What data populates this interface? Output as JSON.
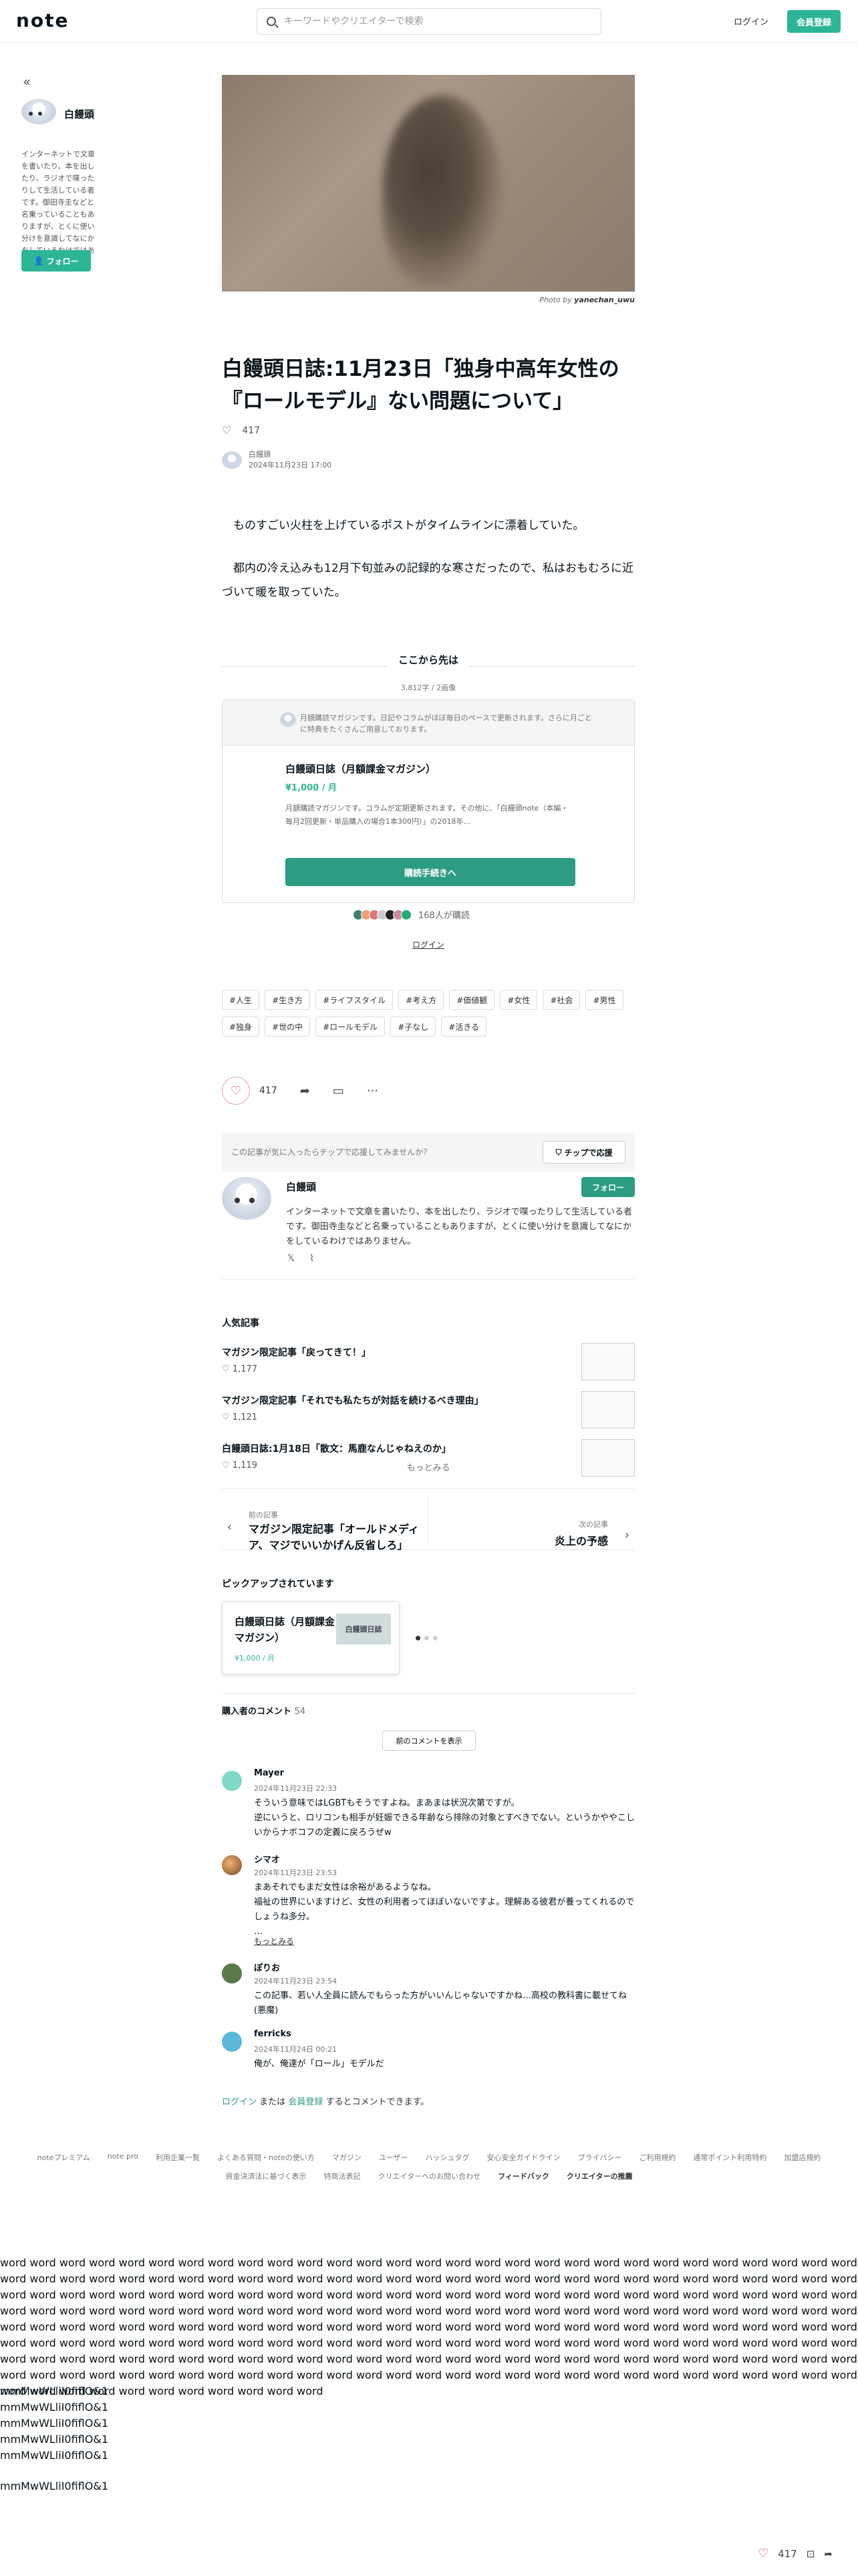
{
  "header": {
    "logo": "note",
    "search_placeholder": "キーワードやクリエイターで検索",
    "login": "ログイン",
    "signup": "会員登録"
  },
  "sidebar": {
    "collapse": "«",
    "name": "白饅頭",
    "bio": "インターネットで文章を書いたり、本を出したり、ラジオで喋ったりして生活している者です。御田寺圭などと名乗っていることもありますが、とくに使い分けを意識してなにかをしているわけではありません。",
    "follow": "フォロー"
  },
  "article": {
    "photo_credit_prefix": "Photo by",
    "photo_credit_name": "yanechan_uwu",
    "title": "白饅頭日誌:11月23日「独身中高年女性の『ロールモデル』ない問題について」",
    "like_count": "417",
    "author_name": "白饅頭",
    "date": "2024年11月23日 17:00",
    "p1": "ものすごい火柱を上げているポストがタイムラインに漂着していた。",
    "p2": "都内の冷え込みも12月下旬並みの記録的な寒さだったので、私はおもむろに近づいて暖を取っていた。"
  },
  "paywall": {
    "heading": "ここから先は",
    "count": "3,812字 / 2画像",
    "notice": "月額購読マガジンです。日記やコラムがほぼ毎日のペースで更新されます。さらに月ごとに特典をたくさんご用意しております。",
    "magazine_title": "白饅頭日誌（月額課金マガジン）",
    "price": "¥1,000 / 月",
    "desc": "月額購読マガジンです。コラムが定期更新されます。その他に、「白饅頭note（本編・毎月2回更新・単品購入の場合1本300円）」の2018年…",
    "buy": "購読手続きへ",
    "buyers": "168人が購読",
    "login": "ログイン"
  },
  "tags": [
    "#人生",
    "#生き方",
    "#ライフスタイル",
    "#考え方",
    "#価値観",
    "#女性",
    "#社会",
    "#男性",
    "#独身",
    "#世の中",
    "#ロールモデル",
    "#子なし",
    "#活きる"
  ],
  "actions": {
    "like_count": "417"
  },
  "tip": {
    "text": "この記事が気に入ったらチップで応援してみませんか？",
    "button": "チップで応援"
  },
  "creator": {
    "name": "白饅頭",
    "follow": "フォロー",
    "bio": "インターネットで文章を書いたり、本を出したり、ラジオで喋ったりして生活している者です。御田寺圭などと名乗っていることもありますが、とくに使い分けを意識してなにかをしているわけではありません。"
  },
  "popular": {
    "heading": "人気記事",
    "items": [
      {
        "title": "マガジン限定記事「戻ってきて！」",
        "likes": "1,177"
      },
      {
        "title": "マガジン限定記事「それでも私たちが対話を続けるべき理由」",
        "likes": "1,121"
      },
      {
        "title": "白饅頭日誌:1月18日「散文：馬鹿なんじゃねえのか」",
        "likes": "1,119"
      }
    ],
    "more": "もっとみる"
  },
  "navigation": {
    "prev_label": "前の記事",
    "prev_title": "マガジン限定記事「オールドメディア、マジでいいかげん反省しろ」",
    "next_label": "次の記事",
    "next_title": "炎上の予感"
  },
  "pickup": {
    "heading": "ピックアップされています",
    "name": "白饅頭日誌（月額課金マガジン）",
    "price": "¥1,000 / 月",
    "thumb_text": "白饅頭日誌"
  },
  "comments": {
    "heading": "購入者のコメント",
    "count": "54",
    "prev_button": "前のコメントを表示",
    "items": [
      {
        "name": "Mayer",
        "date": "2024年11月23日 22:33",
        "body": "そういう意味ではLGBTもそうですよね。まあまは状況次第ですが。\n逆にいうと、ロリコンも相手が妊娠できる年齢なら排除の対象とすべきでない。というかややこしいからナボコフの定義に戻ろうぜw",
        "more": ""
      },
      {
        "name": "シマオ",
        "date": "2024年11月23日 23:53",
        "body": "まあそれでもまだ女性は余裕があるようなね。\n福祉の世界にいますけど、女性の利用者ってほぼいないですよ。理解ある彼君が養ってくれるのでしょうね多分。\n…",
        "more": "もっとみる"
      },
      {
        "name": "ぽりお",
        "date": "2024年11月23日 23:54",
        "body": "この記事、若い人全員に読んでもらった方がいいんじゃないですかね…高校の教科書に載せてね(悪魔)",
        "more": ""
      },
      {
        "name": "ferricks",
        "date": "2024年11月24日 00:21",
        "body": "俺が、俺達が「ロール」モデルだ",
        "more": ""
      }
    ],
    "login_prefix": "ログイン",
    "login_or": "または",
    "signup": "会員登録",
    "login_suffix": "するとコメントできます。"
  },
  "footer": {
    "links": [
      "noteプレミアム",
      "note pro",
      "利用企業一覧",
      "よくある質問・noteの使い方",
      "マガジン",
      "ユーザー",
      "ハッシュタグ",
      "安心安全ガイドライン",
      "プライバシー",
      "ご利用規約",
      "通常ポイント利用特約",
      "加盟店規約",
      "資金決済法に基づく表示",
      "特商法表記",
      "クリエイターへのお問い合わせ",
      "フィードバック",
      "クリエイターの推薦"
    ],
    "bold_links": [
      "フィードバック",
      "クリエイターの推薦"
    ]
  },
  "filler": {
    "words": "word word word word word word word word word word word word word word word word word word word word word word word word word word word word word word word word word word word word word word word word word word word word word word word word word word word word word word word word word word word word word word word word word word word word word word word word word word word word word word word word word word word word word word word word word word word word word word word word word word word word word word word word word word word word word word word word word word word word word word word word word word word word word word word word word word word word word word word word word word word word word word word word word word word word word word word word word word word word word word word word word word word word word word word word word word word word word word word word word word word word word word word word word word word word word word word word word word word word word word word word word word word word word word word word word word word word word word word word word word word word word word word word word word word word word word word word word word word word word word word word word word word",
    "glyphs": [
      "mmMwWLliI0fiflO&1",
      "mmMwWLliI0fiflO&1",
      "mmMwWLliI0fiflO&1",
      "mmMwWLliI0fiflO&1",
      "mmMwWLliI0fiflO&1"
    ],
    "glyph_single": "mmMwWLliI0fiflO&1"
  },
  "float_bar": {
    "like_count": "417"
  }
}
